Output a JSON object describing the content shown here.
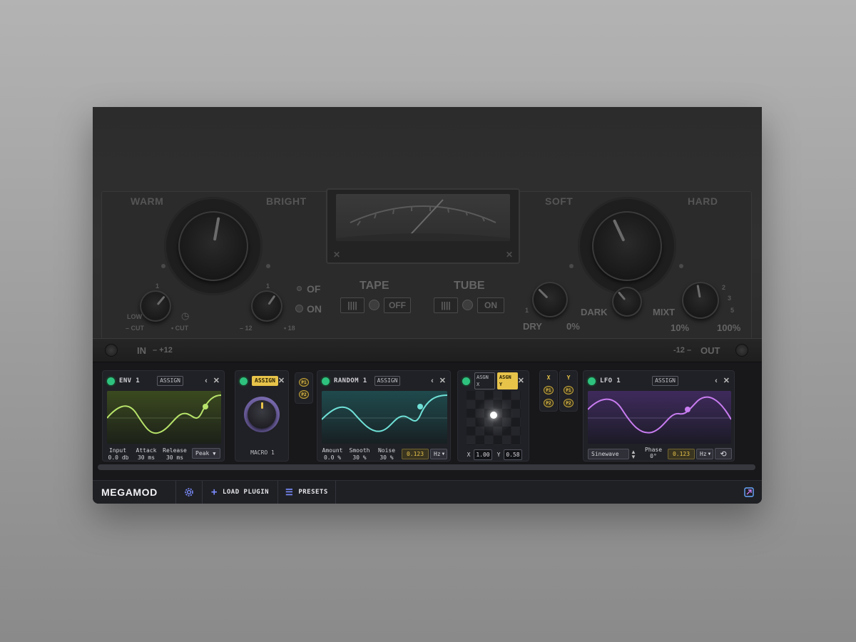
{
  "host": {
    "warm_label": "WARM",
    "bright_label": "BRIGHT",
    "soft_label": "SOFT",
    "hard_label": "HARD",
    "of_label": "OF",
    "on_label": "ON",
    "tape_label": "TAPE",
    "tube_label": "TUBE",
    "tape_state": "OFF",
    "tube_state": "ON",
    "dark_label": "DARK",
    "mixt_label": "MIXT",
    "dry_label": "DRY",
    "dry_value": "0%",
    "mix_value_left": "10%",
    "mix_value_right": "100%",
    "cut_left": "– CUT",
    "cut_right": "• CUT",
    "low_label": "LOW",
    "minus12": "– 12",
    "plus18": "• 18",
    "one_a": "1",
    "one_b": "1",
    "one_c": "1",
    "two": "2",
    "three": "3",
    "five": "5",
    "in_label": "IN",
    "in_value": "– +12",
    "out_value": "-12 –",
    "out_label": "OUT",
    "vu_x": "✕"
  },
  "modulators": {
    "env": {
      "title": "ENV 1",
      "assign": "ASSIGN",
      "params": [
        {
          "label": "Input",
          "value": "0.0 db"
        },
        {
          "label": "Attack",
          "value": "30 ms"
        },
        {
          "label": "Release",
          "value": "30 ms"
        }
      ],
      "mode": "Peak"
    },
    "macro": {
      "assign": "ASSIGN",
      "label": "MACRO 1",
      "value": 0.5
    },
    "pills_1": [
      "P1",
      "P2"
    ],
    "random": {
      "title": "RANDOM 1",
      "assign": "ASSIGN",
      "params": [
        {
          "label": "Amount",
          "value": "0.0 %"
        },
        {
          "label": "Smooth",
          "value": "30 %"
        },
        {
          "label": "Noise",
          "value": "30 %"
        }
      ],
      "rate": "0.123",
      "unit": "Hz"
    },
    "xy": {
      "assign_x": "ASGN X",
      "assign_y": "ASGN Y",
      "x_label": "X",
      "x_value": "1.00",
      "y_label": "Y",
      "y_value": "0.58"
    },
    "pills_x": {
      "head": "X",
      "items": [
        "P1",
        "P2"
      ]
    },
    "pills_y": {
      "head": "Y",
      "items": [
        "P1",
        "P2"
      ]
    },
    "lfo": {
      "title": "LFO 1",
      "assign": "ASSIGN",
      "shape": "Sinewave",
      "phase_label": "Phase",
      "phase_value": "0°",
      "rate": "0.123",
      "unit": "Hz"
    }
  },
  "toolbar": {
    "logo": "MEGAMOD",
    "load_plugin": "LOAD PLUGIN",
    "presets": "PRESETS"
  },
  "colors": {
    "accent_green": "#2ec27e",
    "accent_yellow": "#e7c34a",
    "env_wave": "#b7e36a",
    "random_wave": "#6fe0d6",
    "lfo_wave": "#c87cf0"
  }
}
